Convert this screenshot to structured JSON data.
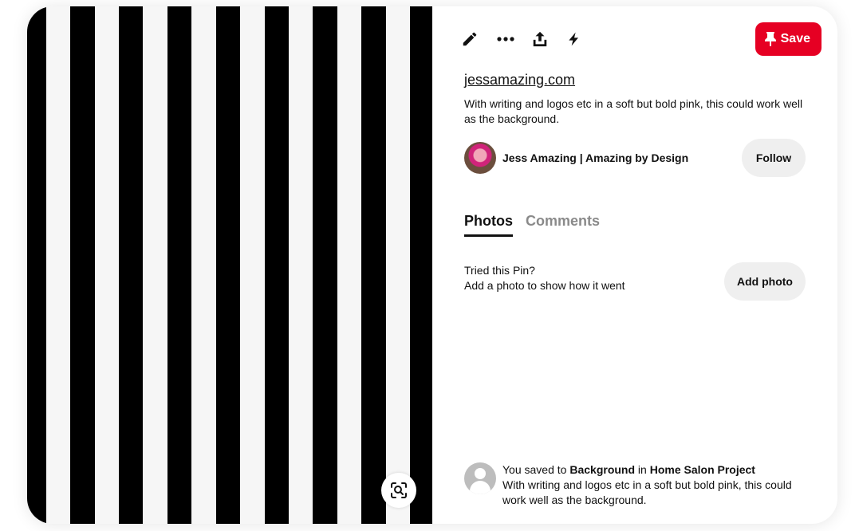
{
  "toolbar": {
    "icons": [
      "pencil-icon",
      "more-icon",
      "share-icon",
      "lightning-icon"
    ],
    "save_label": "Save",
    "save_color": "#e60023"
  },
  "pin": {
    "source": "jessamazing.com",
    "description": "With writing and logos etc in a soft but bold pink, this could work well as the background."
  },
  "creator": {
    "name": "Jess Amazing | Amazing by Design",
    "follow_label": "Follow"
  },
  "tabs": [
    {
      "label": "Photos",
      "active": true
    },
    {
      "label": "Comments",
      "active": false
    }
  ],
  "tried": {
    "line1": "Tried this Pin?",
    "line2": "Add a photo to show how it went",
    "button_label": "Add photo"
  },
  "saved": {
    "prefix": "You saved to",
    "board": "Background",
    "connector": "in",
    "project": "Home Salon Project",
    "note": "With writing and logos etc in a soft but bold pink, this could work well as the background."
  }
}
